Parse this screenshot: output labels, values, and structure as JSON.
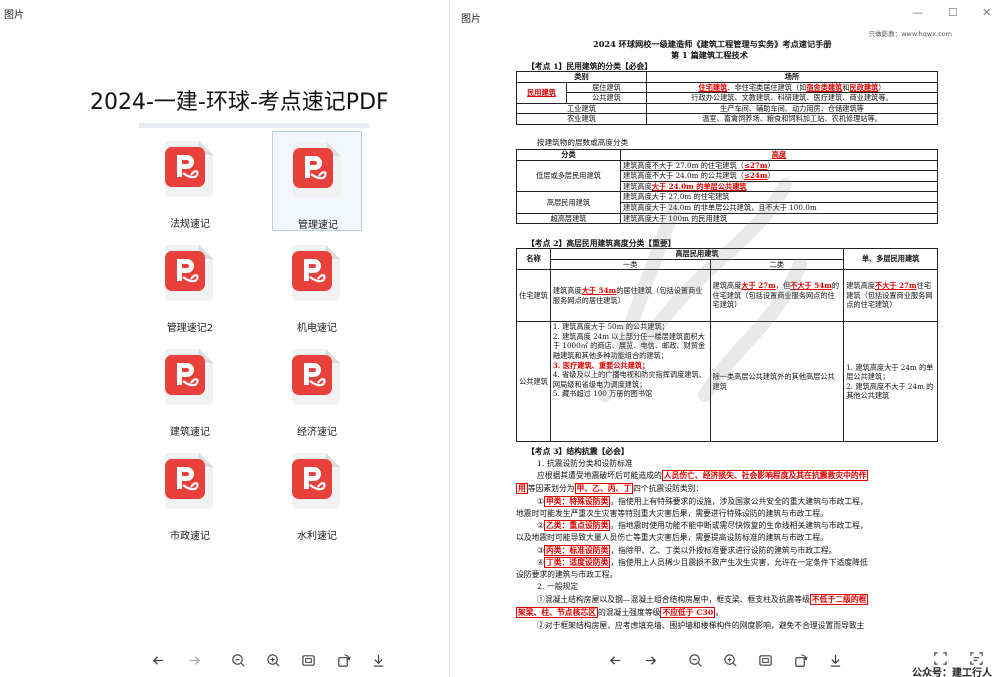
{
  "left_window": {
    "title": "图片",
    "heading": "2024-一建-环球-考点速记PDF",
    "files": [
      "法规速记",
      "管理速记",
      "管理速记2",
      "机电速记",
      "建筑速记",
      "经济速记",
      "市政速记",
      "水利速记"
    ],
    "selected": "管理速记"
  },
  "right_window": {
    "title": "图片",
    "site_line": "只做影教：www.hqwx.com",
    "doc_title": "2024 环球网校一级建造师《建筑工程管理与实务》考点速记手册",
    "chapter": "第 1 篇建筑工程技术",
    "k1_title": "【考点 1】民用建筑的分类【必会】",
    "t1": {
      "h_type": "类别",
      "h_place": "场所",
      "civil": "民用建筑",
      "res": "居住建筑",
      "res_place_pre": "住宅建筑",
      "res_place_mid": "、非住宅类居住建筑（如",
      "res_place_red": "宿舍类建筑",
      "res_place_and": "和",
      "res_place_red2": "民政建筑",
      "res_place_end": "）",
      "pub": "公共建筑",
      "pub_place": "行政办公建筑、文教建筑、科研建筑、医疗建筑、商业建筑等。",
      "ind": "工业建筑",
      "ind_place": "生产车间、辅助车间、动力用房、仓储建筑等",
      "agr": "农业建筑",
      "agr_place": "温室、畜禽饲养场、粮食和饲料加工站、农机修理站等。"
    },
    "t2_caption": "按建筑物的层数或高度分类",
    "t2": {
      "h_cat": "分类",
      "h_height": "高度",
      "low": "低层或多层民用建筑",
      "low1_pre": "建筑高度不大于 27.0m 的住宅建筑（",
      "low1_red": "≤27m",
      "low1_end": "）",
      "low2_pre": "建筑高度不大于 24.0m 的公共建筑（",
      "low2_red": "≤24m",
      "low2_end": "）",
      "low3_pre": "建筑高度",
      "low3_red": "大于 24.0m 的单层公共建筑",
      "high": "高层民用建筑",
      "high1": "建筑高度大于 27.0m 的住宅建筑",
      "high2": "建筑高度大于 24.0m 的非单层公共建筑，且不大于 100.0m",
      "super": "超高层建筑",
      "super1": "建筑高度大于 100m 的民用建筑"
    },
    "k2_title": "【考点 2】高层民用建筑高度分类【重要】",
    "t3": {
      "h_name": "名称",
      "h_high": "高层民用建筑",
      "h_one": "一类",
      "h_two": "二类",
      "h_multi": "单、多层民用建筑",
      "res": "住宅建筑",
      "res_one_pre": "建筑高度",
      "res_one_red": "大于 54m",
      "res_one_end": "的居住建筑（包括设置商业服务网点的居住建筑）",
      "res_two_pre": "建筑高度",
      "res_two_red": "大于 27m",
      "res_two_mid": "，但",
      "res_two_red2": "不大于 54m",
      "res_two_end": "的住宅建筑（包括设置商业服务网点的住宅建筑）",
      "res_multi_pre": "建筑高度",
      "res_multi_red": "不大于 27m",
      "res_multi_end": "住宅建筑（包括设置商业服务网点的住宅建筑）",
      "pub": "公共建筑",
      "pub_one": [
        "1. 建筑高度大于 50m 的公共建筑；",
        "2. 建筑高度 24m 以上部分任一楼层建筑面积大于 1000㎡ 的商店、展览、电信、邮政、财贸金融建筑和其他多种功能组合的建筑；",
        "3. 医疗建筑、重要公共建筑；",
        "4. 省级及以上的广播电视和防灾指挥调度建筑、网局级和省级电力调度建筑；",
        "5. 藏书超过 100 万册的图书馆"
      ],
      "pub_two": "除一类高层公共建筑外的其他高层公共建筑",
      "pub_multi": [
        "1. 建筑高度大于 24m 的单层公共建筑；",
        "2. 建筑高度不大于 24m 的其他公共建筑"
      ]
    },
    "k3_title": "【考点 3】结构抗震【必会】",
    "p1": "1. 抗震设防分类和设防标准",
    "p2_pre": "应根据其遭受地震破坏后可能造成的",
    "p2_red": "人员伤亡、经济损失、社会影响程度及其在抗震救灾中的作",
    "p3_red": "用",
    "p3_mid": "等因素划分为",
    "p3_red2": "甲、乙、丙、丁",
    "p3_end": "四个抗震设防类别：",
    "p4_pre": "①",
    "p4_red": "甲类：特殊设防类",
    "p4_end": "。指使用上有特殊要求的设施，涉及国家公共安全的重大建筑与市政工程，",
    "p5": "地震时可能发生严重次生灾害等特别重大灾害后果，需要进行特殊设防的建筑与市政工程。",
    "p6_pre": "②",
    "p6_red": "乙类：重点设防类",
    "p6_end": "。指地震时使用功能不能中断或需尽快恢复的生命线相关建筑与市政工程，",
    "p7": "以及地震时可能导致大量人员伤亡等重大灾害后果，需要提高设防标准的建筑与市政工程。",
    "p8_pre": "③",
    "p8_red": "丙类：标准设防类",
    "p8_end": "，指除甲、乙、丁类以外按标准要求进行设防的建筑与市政工程。",
    "p9_pre": "④",
    "p9_red": "丁类：适度设防类",
    "p9_end": "，指使用上人员稀少且震损不致产生次生灾害，允许在一定条件下适度降低",
    "p10": "设防要求的建筑与市政工程。",
    "p11": "2. 一般规定",
    "p12_pre": "①混凝土结构房屋以及钢—混凝土组合结构房屋中，框支梁、框支柱及抗震等级",
    "p12_red": "不低于二级的框",
    "p13_red": "架梁、柱、节点核芯区",
    "p13_mid": "的混凝土强度等级",
    "p13_red2": "不应低于 C30",
    "p13_end": "。",
    "p14": "②对于框架结构房屋，应考虑填充墙、围护墙和楼梯构件的刚度影响，避免不合理设置而导致主",
    "footer": "公众号：建工行人"
  },
  "colors": {
    "accent_red": "#e00000",
    "pdf_red": "#e8413c"
  }
}
